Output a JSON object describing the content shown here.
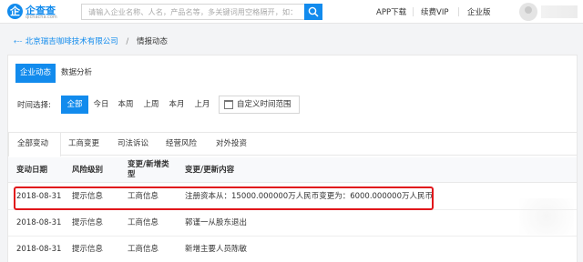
{
  "header": {
    "logo_glyph": "企",
    "logo_text": "企查查",
    "logo_sub": "qichacha.com",
    "search_placeholder": "请输入企业名称、人名，产品名等，多关键词用空格隔开，如：",
    "nav": [
      "APP下载",
      "续费VIP",
      "企业版"
    ]
  },
  "breadcrumb": {
    "icon": "back-arrow-icon",
    "company": "北京瑞吉咖啡技术有限公司",
    "separator": "/",
    "current": "情报动态"
  },
  "tabs": [
    "企业动态",
    "数据分析"
  ],
  "time_filter": {
    "label": "时间选择:",
    "options": [
      "全部",
      "今日",
      "本周",
      "上周",
      "本月",
      "上月"
    ],
    "active": "全部",
    "custom_range": "自定义时间范围"
  },
  "sub_tabs": [
    "全部变动",
    "工商变更",
    "司法诉讼",
    "经营风险",
    "对外投资"
  ],
  "table": {
    "headers": [
      "变动日期",
      "风险级别",
      "变更/新增类型",
      "变更/更新内容"
    ],
    "header_type_line1": "变更/新增类",
    "header_type_line2": "型",
    "rows": [
      {
        "date": "2018-08-31",
        "level": "提示信息",
        "type": "工商信息",
        "content": "注册资本从：15000.000000万人民币变更为：6000.000000万人民币"
      },
      {
        "date": "2018-08-31",
        "level": "提示信息",
        "type": "工商信息",
        "content": "郭谨一从股东退出"
      },
      {
        "date": "2018-08-31",
        "level": "提示信息",
        "type": "工商信息",
        "content": "新增主要人员陈敏"
      }
    ]
  },
  "colors": {
    "accent": "#128bed",
    "highlight_border": "#e1161b"
  }
}
